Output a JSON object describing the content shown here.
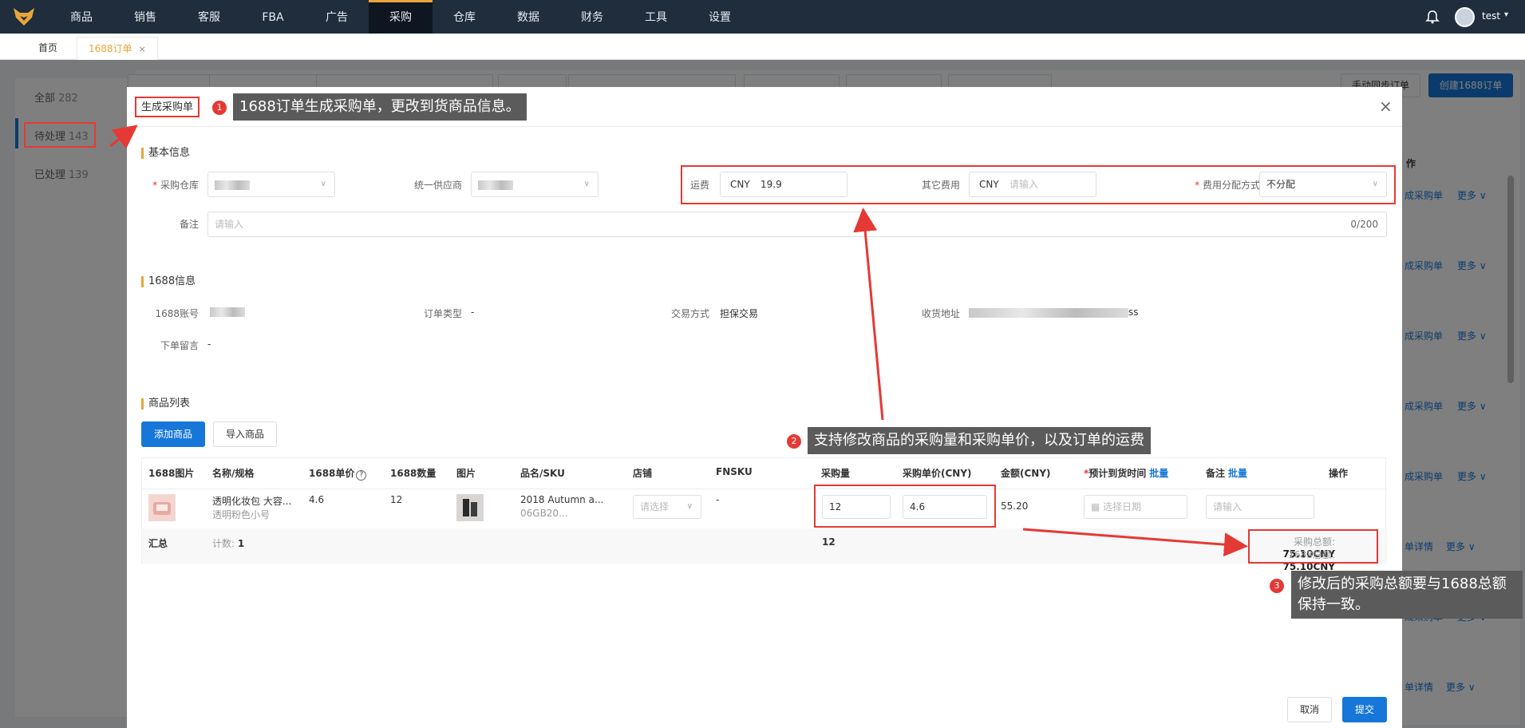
{
  "topnav": {
    "items": [
      "商品",
      "销售",
      "客服",
      "FBA",
      "广告",
      "采购",
      "仓库",
      "数据",
      "财务",
      "工具",
      "设置"
    ],
    "username": "test"
  },
  "tabs": [
    {
      "label": "首页"
    },
    {
      "label": "1688订单",
      "close": "×"
    }
  ],
  "sidebar": {
    "items": [
      {
        "label": "全部",
        "count": "282"
      },
      {
        "label": "待处理",
        "count": "143"
      },
      {
        "label": "已处理",
        "count": "139"
      }
    ]
  },
  "background": {
    "btn_manual_sync": "手动同步订单",
    "btn_create": "创建1688订单",
    "col_ops": "作",
    "link_generate": "成采购单",
    "link_detail": "单详情",
    "link_more": "更多 ∨"
  },
  "modal": {
    "title": "生成采购单",
    "close": "×",
    "basic": {
      "section_title": "基本信息",
      "warehouse_label": "采购仓库",
      "supplier_label": "统一供应商",
      "freight_label": "运费",
      "freight_currency": "CNY",
      "freight_value": "19.9",
      "other_fee_label": "其它费用",
      "other_fee_currency": "CNY",
      "other_fee_placeholder": "请输入",
      "allocation_label": "费用分配方式",
      "allocation_value": "不分配",
      "remark_label": "备注",
      "remark_placeholder": "请输入",
      "remark_count": "0/200"
    },
    "info1688": {
      "section_title": "1688信息",
      "account_label": "1688账号",
      "order_type_label": "订单类型",
      "order_type_value": "-",
      "trade_label": "交易方式",
      "trade_value": "担保交易",
      "address_label": "收货地址",
      "address_tail": "ss",
      "message_label": "下单留言",
      "message_value": "-"
    },
    "products": {
      "section_title": "商品列表",
      "add_button": "添加商品",
      "import_button": "导入商品",
      "columns": [
        "1688图片",
        "名称/规格",
        "1688单价",
        "1688数量",
        "图片",
        "品名/SKU",
        "店铺",
        "FNSKU",
        "采购量",
        "采购单价(CNY)",
        "金额(CNY)",
        "预计到货时间",
        "备注",
        "操作"
      ],
      "batch_label": "批量",
      "help_icon": "?",
      "row": {
        "name": "透明化妆包 大容...",
        "spec": "透明粉色小号",
        "price_1688": "4.6",
        "qty_1688": "12",
        "product_name": "2018 Autumn a...",
        "sku": "06GB20...",
        "store_placeholder": "请选择",
        "fnsku": "-",
        "purchase_qty": "12",
        "purchase_price": "4.6",
        "amount": "55.20",
        "date_placeholder": "选择日期",
        "remark_placeholder": "请输入"
      },
      "summary": {
        "label": "汇总",
        "count_label": "计数:",
        "count_value": "1",
        "qty_total": "12",
        "purchase_total_label": "采购总额:",
        "purchase_total": "75.10CNY",
        "total_1688_label": "1688总额:",
        "total_1688": "75.10CNY"
      }
    },
    "footer": {
      "cancel": "取消",
      "submit": "提交"
    }
  },
  "annotations": {
    "a1_num": "1",
    "a1_text": "1688订单生成采购单，更改到货商品信息。",
    "a2_num": "2",
    "a2_text": "支持修改商品的采购量和采购单价，以及订单的运费",
    "a3_num": "3",
    "a3_text_line1": "修改后的采购总额要与1688总额",
    "a3_text_line2": "保持一致。"
  },
  "colors": {
    "nav_bg": "#1f2d3d",
    "accent": "#e8a53b",
    "primary": "#1677d9",
    "annotation_red": "#e53935",
    "callout_bg": "#5b5b5b"
  }
}
